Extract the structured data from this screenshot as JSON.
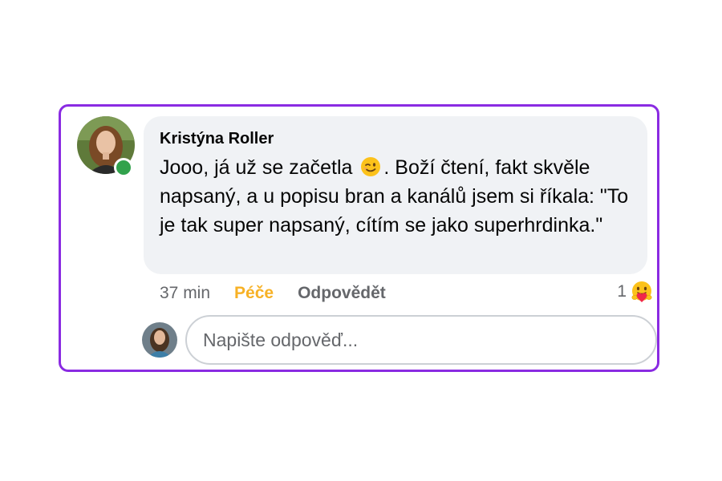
{
  "comment": {
    "author": "Kristýna Roller",
    "text_before_emoji": "Jooo, já už se začetla ",
    "emoji": "winking-face",
    "text_after_emoji": ". Boží čtení, fakt skvěle napsaný, a u popisu bran a kanálů jsem si říkala: \"To je tak super napsaný, cítím se jako superhrdinka.\"",
    "online": true
  },
  "actions": {
    "time": "37 min",
    "care_label": "Péče",
    "reply_label": "Odpovědět"
  },
  "reactions": {
    "count": "1",
    "type": "care-emoji"
  },
  "reply_box": {
    "placeholder": "Napište odpověď..."
  },
  "colors": {
    "frame_border": "#8a2be2",
    "bubble_bg": "#f0f2f5",
    "care_accent": "#f7b125",
    "online_dot": "#31a24c",
    "secondary_text": "#65676b"
  }
}
